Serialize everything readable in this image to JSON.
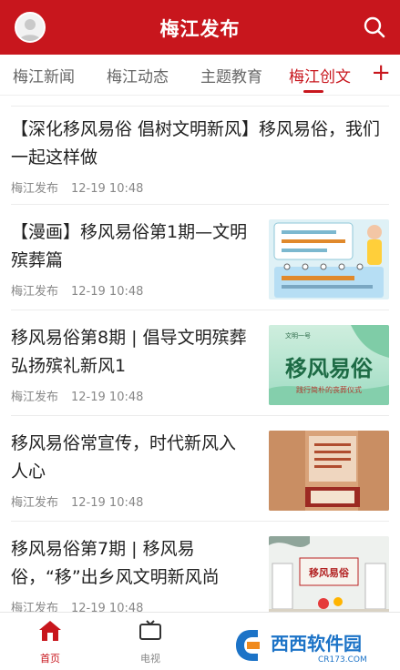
{
  "header": {
    "title": "梅江发布"
  },
  "tabs": [
    {
      "label": "梅江新闻"
    },
    {
      "label": "梅江动态"
    },
    {
      "label": "主题教育"
    },
    {
      "label": "梅江创文"
    }
  ],
  "tab_add": "+",
  "articles": [
    {
      "title": "【深化移风易俗 倡树文明新风】移风易俗，我们一起这样做",
      "source": "梅江发布",
      "time": "12-19 10:48"
    },
    {
      "title": "【漫画】移风易俗第1期—文明殡葬篇",
      "source": "梅江发布",
      "time": "12-19 10:48"
    },
    {
      "title": "移风易俗第8期 | 倡导文明殡葬 弘扬殡礼新风1",
      "source": "梅江发布",
      "time": "12-19 10:48",
      "thumb_text": {
        "badge": "文明一号",
        "main": "移风易俗",
        "sub": "践行简朴的丧葬仪式"
      }
    },
    {
      "title": "移风易俗常宣传，时代新风入人心",
      "source": "梅江发布",
      "time": "12-19 10:48"
    },
    {
      "title": "移风易俗第7期 | 移风易俗，“移”出乡风文明新风尚",
      "source": "梅江发布",
      "time": "12-19 10:48",
      "thumb_text": {
        "sign": "移风易俗"
      }
    }
  ],
  "bottom_nav": [
    {
      "label": "首页",
      "icon": "home-icon"
    },
    {
      "label": "电视",
      "icon": "tv-icon"
    }
  ],
  "watermark": {
    "main": "西西软件园",
    "sub": "CR173.COM"
  },
  "colors": {
    "brand": "#c8161d",
    "text": "#222222",
    "meta": "#888888"
  }
}
